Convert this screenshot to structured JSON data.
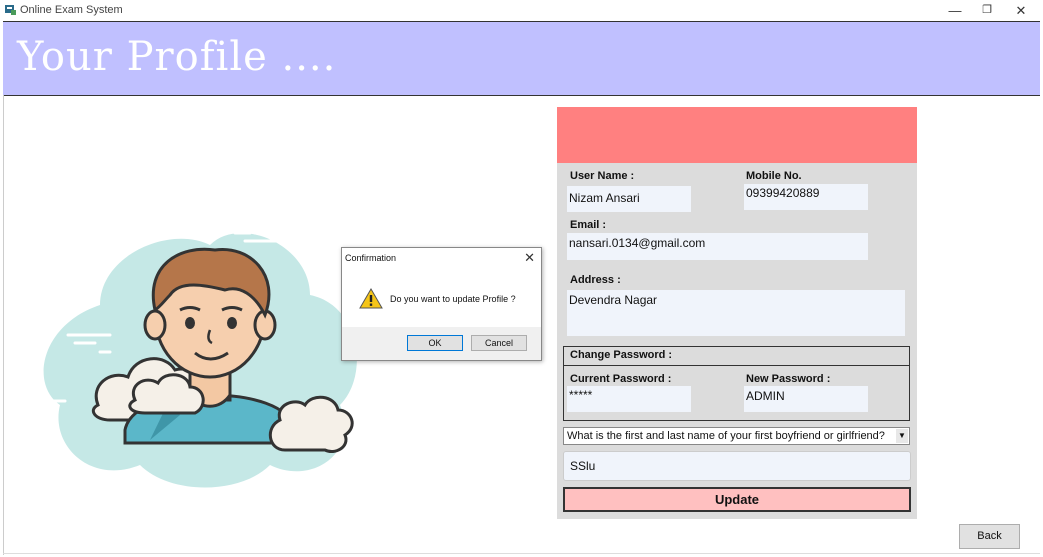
{
  "window": {
    "title": "Online Exam System",
    "minimize_glyph": "—",
    "restore_glyph": "❐",
    "close_glyph": "✕"
  },
  "header": {
    "title": "Your Profile ...."
  },
  "form": {
    "user_name_label": "User Name :",
    "user_name_value": "Nizam Ansari",
    "mobile_label": "Mobile No.",
    "mobile_value": "09399420889",
    "email_label": "Email :",
    "email_value": "nansari.0134@gmail.com",
    "address_label": "Address :",
    "address_value": "Devendra Nagar",
    "change_password_label": "Change Password :",
    "current_password_label": "Current Password :",
    "current_password_value": "*****",
    "new_password_label": "New Password :",
    "new_password_value": "ADMIN",
    "security_question": "What is the first and last name of your first boyfriend or girlfriend?",
    "security_answer": "SSlu",
    "update_label": "Update"
  },
  "back_label": "Back",
  "dialog": {
    "title": "Confirmation",
    "close_glyph": "✕",
    "message": "Do you want to update Profile ?",
    "ok_label": "OK",
    "cancel_label": "Cancel"
  },
  "colors": {
    "banner": "#c0c0ff",
    "panel_header": "#ff8080",
    "update_button": "#ffc0c0",
    "cloud": "#c5e8e6"
  }
}
